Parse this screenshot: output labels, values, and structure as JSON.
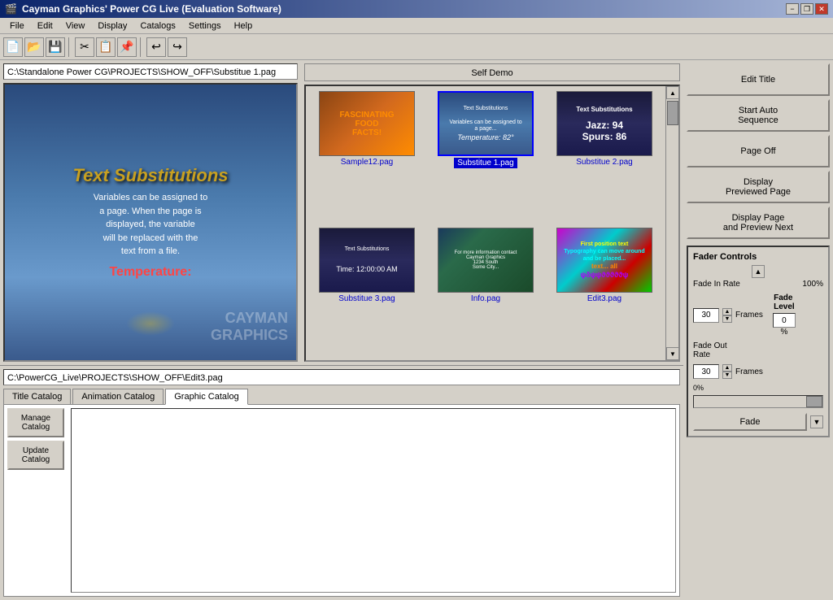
{
  "titlebar": {
    "title": "Cayman Graphics' Power CG Live (Evaluation Software)",
    "icon": "🎬",
    "minimize_label": "−",
    "restore_label": "❐",
    "close_label": "✕"
  },
  "menubar": {
    "items": [
      "File",
      "Edit",
      "View",
      "Display",
      "Catalogs",
      "Settings",
      "Help"
    ]
  },
  "toolbar": {
    "buttons": [
      {
        "name": "new",
        "icon": "📄"
      },
      {
        "name": "open",
        "icon": "📂"
      },
      {
        "name": "save",
        "icon": "💾"
      },
      {
        "name": "cut",
        "icon": "✂"
      },
      {
        "name": "copy",
        "icon": "📋"
      },
      {
        "name": "paste",
        "icon": "📌"
      },
      {
        "name": "undo",
        "icon": "↩"
      },
      {
        "name": "redo",
        "icon": "↪"
      }
    ]
  },
  "preview": {
    "path": "C:\\Standalone Power CG\\PROJECTS\\SHOW_OFF\\Substitue 1.pag",
    "title_text": "Text Substitutions",
    "body_text": "Variables can be assigned to\na page. When the page is\ndisplayed, the variable\nwill be replaced with the\ntext from a file.",
    "temp_label": "Temperature:"
  },
  "catalog_panel": {
    "header": "Self Demo",
    "thumbnails": [
      {
        "id": "thumb1",
        "filename": "Sample12.pag",
        "bg": "food",
        "selected": false
      },
      {
        "id": "thumb2",
        "filename": "Substitue 1.pag",
        "bg": "text1",
        "selected": true
      },
      {
        "id": "thumb3",
        "filename": "Substitue 2.pag",
        "bg": "text2",
        "selected": false
      },
      {
        "id": "thumb4",
        "filename": "Substitue 3.pag",
        "bg": "text3",
        "selected": false
      },
      {
        "id": "thumb5",
        "filename": "Info.pag",
        "bg": "parrot",
        "selected": false
      },
      {
        "id": "thumb6",
        "filename": "Edit3.pag",
        "bg": "edit",
        "selected": false
      }
    ]
  },
  "bottom_panel": {
    "path": "C:\\PowerCG_Live\\PROJECTS\\SHOW_OFF\\Edit3.pag",
    "tabs": [
      {
        "label": "Title Catalog",
        "active": false
      },
      {
        "label": "Animation Catalog",
        "active": false
      },
      {
        "label": "Graphic Catalog",
        "active": true
      }
    ],
    "buttons": [
      {
        "label": "Manage\nCatalog"
      },
      {
        "label": "Update\nCatalog"
      }
    ]
  },
  "right_panel": {
    "buttons": [
      {
        "label": "Edit Title"
      },
      {
        "label": "Start Auto\nSequence"
      },
      {
        "label": "Page Off"
      },
      {
        "label": "Display\nPreviewed Page"
      },
      {
        "label": "Display Page\nand Preview Next"
      }
    ]
  },
  "fader": {
    "title": "Fader Controls",
    "fade_in_rate_label": "Fade In Rate",
    "fade_in_value": "30",
    "fade_in_pct": "100%",
    "frames_label1": "Frames",
    "fade_out_rate_label": "Fade Out Rate",
    "fade_out_value": "30",
    "frames_label2": "Frames",
    "fade_level_label": "Fade\nLevel",
    "fade_level_value": "0",
    "fade_level_pct": "%",
    "zero_pct_label": "0%",
    "fade_btn_label": "Fade"
  }
}
